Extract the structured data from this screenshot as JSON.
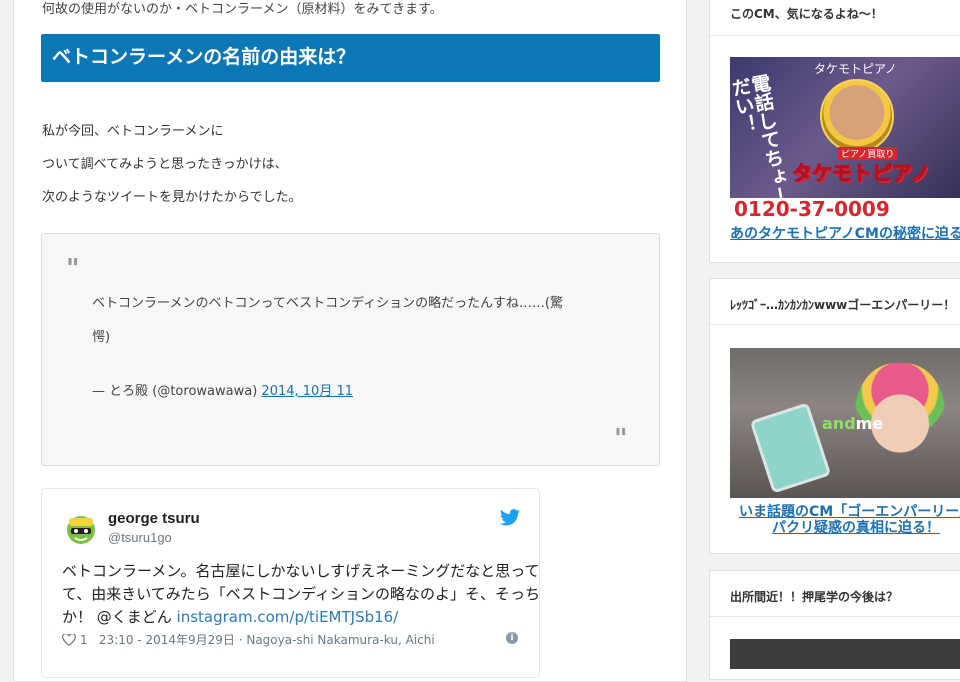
{
  "article": {
    "cut_line": "何故の使用がないのか・ベトコンラーメン（原材料）をみてきます。",
    "heading": "ベトコンラーメンの名前の由来は？",
    "paragraphs": [
      "私が今回、ベトコンラーメンに",
      "ついて調べてみようと思ったきっかけは、",
      "次のようなツイートを見かけたからでした。"
    ],
    "blockquote": {
      "line1": "ベトコンラーメンのベトコンってベストコンディションの略だったんすね……(驚",
      "line2": "愕)",
      "attribution": "— とろ殿 (@torowawawa)",
      "date_link": "2014, 10月 11"
    },
    "tweet": {
      "name": "george tsuru",
      "handle": "@tsuru1go",
      "lines": [
        "ベトコンラーメン。名古屋にしかないしすげえネーミングだなと思って",
        "て、由来きいてみたら「ベストコンディションの略なのよ」そ、そっち",
        "か！ @くまどん "
      ],
      "link": "instagram.com/p/tiEMTJSb16/",
      "likes": "1",
      "meta": "23:10 - 2014年9月29日 · Nagoya-shi Nakamura-ku, Aichi"
    }
  },
  "sidebar": {
    "widget1": {
      "title": "このCM、気になるよね〜！",
      "ad": {
        "top_text": "タケモトピアノ",
        "call_text": "電話してちょーだい！",
        "badge": "ピアノ買取り",
        "brand": "タケモトピアノ",
        "phone": "0120-37-0009"
      },
      "caption": "あのタケモトピアノCMの秘密に迫る"
    },
    "widget2": {
      "title": "ﾚｯﾂｺﾞｰ…ｶﾝｶﾝｶﾝwwwゴーエンパーリー！",
      "ad": {
        "logo_a": "and",
        "logo_b": "me"
      },
      "caption_line1": "いま話題のCM「ゴーエンパーリー」",
      "caption_line2": "パクリ疑惑の真相に迫る！"
    },
    "widget3": {
      "title": "出所間近！！押尾学の今後は？"
    }
  },
  "colors": {
    "heading_bg": "#0b77b5",
    "link": "#1e6fb0",
    "tweet_link": "#2b7bb9"
  },
  "icons": [
    "quote-open-icon",
    "quote-close-icon",
    "twitter-bird-icon",
    "heart-icon",
    "info-icon",
    "avatar-icon"
  ]
}
